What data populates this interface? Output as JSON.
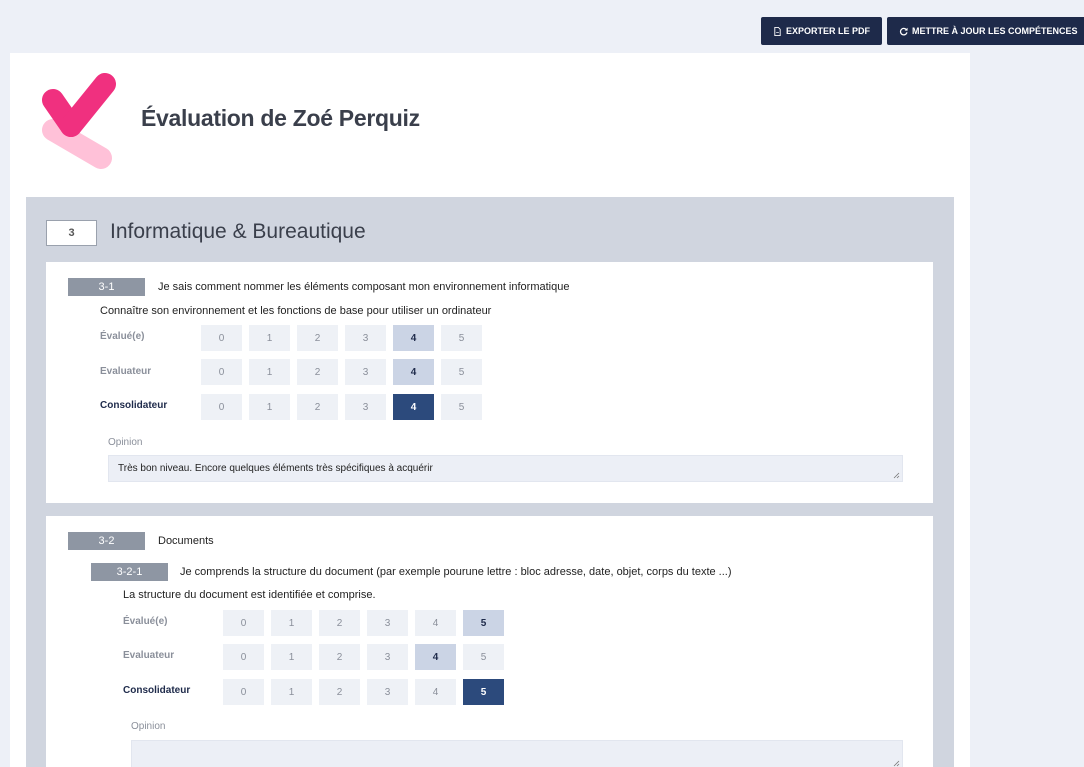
{
  "toolbar": {
    "export_pdf": "EXPORTER LE PDF",
    "update_skills": "METTRE À JOUR LES COMPÉTENCES"
  },
  "page": {
    "title": "Évaluation de Zoé Perquiz"
  },
  "colors": {
    "accent": "#1e2a4a",
    "selected_dark": "#2c4a7c",
    "selected_light": "#cbd4e5",
    "logo_pink": "#f0307f"
  },
  "section": {
    "number": "3",
    "title": "Informatique & Bureautique"
  },
  "scale_values": [
    "0",
    "1",
    "2",
    "3",
    "4",
    "5"
  ],
  "row_labels": {
    "evalue": "Évalué(e)",
    "evaluateur": "Evaluateur",
    "consolidateur": "Consolidateur"
  },
  "opinion_label": "Opinion",
  "items": [
    {
      "code": "3-1",
      "text": "Je sais comment nommer les éléments composant mon environnement informatique",
      "description": "Connaître son environnement et les fonctions de base pour utiliser un ordinateur",
      "evalue": 4,
      "evaluateur": 4,
      "consolidateur": 4,
      "opinion": "Très bon niveau. Encore quelques éléments très spécifiques à acquérir"
    },
    {
      "code": "3-2",
      "text": "Documents",
      "sub": {
        "code": "3-2-1",
        "text": "Je comprends la structure du document (par exemple pourune lettre : bloc adresse, date, objet, corps du texte ...)",
        "description": "La structure du document est identifiée et comprise.",
        "evalue": 5,
        "evaluateur": 4,
        "consolidateur": 5,
        "opinion": ""
      }
    }
  ]
}
